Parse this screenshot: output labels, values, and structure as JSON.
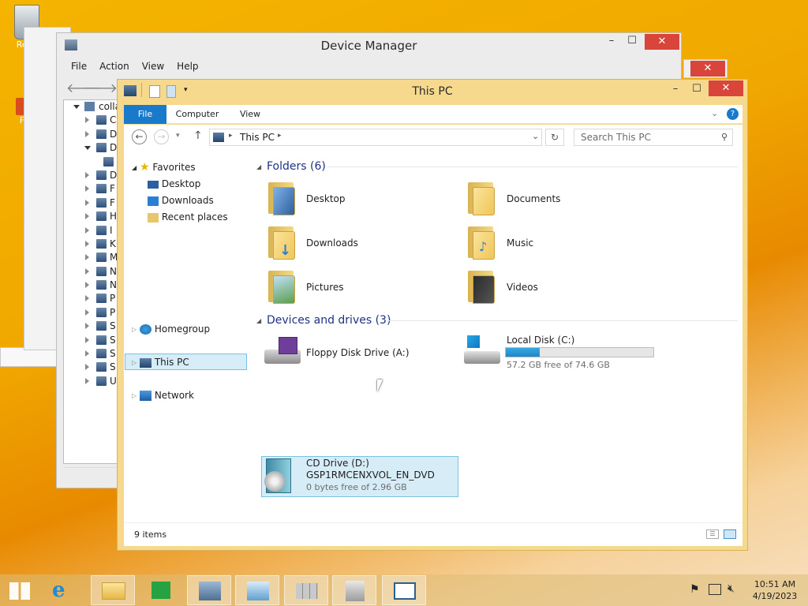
{
  "desktop": {
    "recycle_label": "Recy",
    "shortcut_label": "Fi"
  },
  "device_manager": {
    "title": "Device Manager",
    "menu": [
      "File",
      "Action",
      "View",
      "Help"
    ],
    "tree_root": "colla",
    "tree_items": [
      "C",
      "D",
      "D",
      "",
      "D",
      "F",
      "F",
      "H",
      "I",
      "K",
      "M",
      "N",
      "N",
      "P",
      "P",
      "S",
      "S",
      "S",
      "S",
      "U"
    ]
  },
  "explorer": {
    "title": "This PC",
    "ribbon_tabs": {
      "file": "File",
      "computer": "Computer",
      "view": "View"
    },
    "address": "This PC",
    "search_placeholder": "Search This PC",
    "nav": {
      "favorites": "Favorites",
      "desktop": "Desktop",
      "downloads": "Downloads",
      "recent": "Recent places",
      "homegroup": "Homegroup",
      "this_pc": "This PC",
      "network": "Network"
    },
    "folders_header": "Folders (6)",
    "folders": [
      "Desktop",
      "Documents",
      "Downloads",
      "Music",
      "Pictures",
      "Videos"
    ],
    "drives_header": "Devices and drives (3)",
    "drives": {
      "floppy": {
        "name": "Floppy Disk Drive (A:)"
      },
      "local": {
        "name": "Local Disk (C:)",
        "free": "57.2 GB free of 74.6 GB",
        "used_fraction": 0.23
      },
      "cd": {
        "name": "CD Drive (D:)",
        "label": "GSP1RMCENXVOL_EN_DVD",
        "free": "0 bytes free of 2.96 GB"
      }
    },
    "status": "9 items"
  },
  "taskbar": {
    "time": "10:51 AM",
    "date": "4/19/2023"
  },
  "colors": {
    "accent": "#1979ca",
    "selection": "#d6ecf7",
    "titlebar": "#f6d98c",
    "close": "#d9443b"
  }
}
